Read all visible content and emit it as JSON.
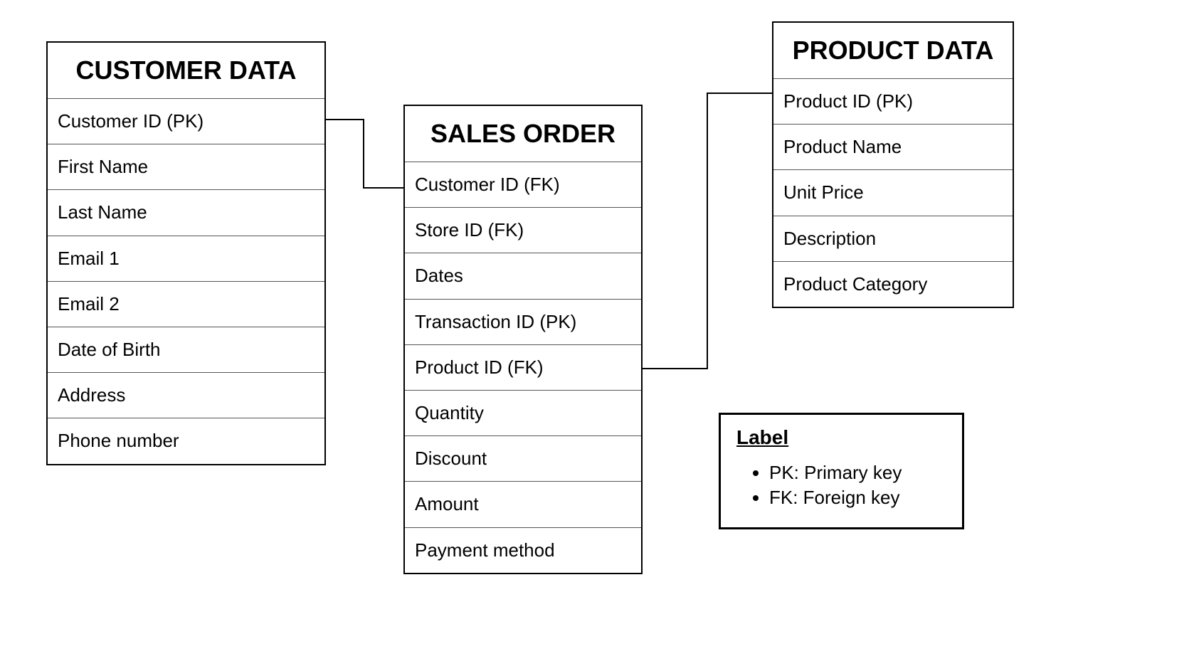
{
  "entities": {
    "customer": {
      "title": "CUSTOMER DATA",
      "fields": [
        "Customer ID (PK)",
        "First Name",
        "Last Name",
        "Email 1",
        "Email 2",
        "Date of Birth",
        "Address",
        "Phone number"
      ]
    },
    "sales": {
      "title": "SALES ORDER",
      "fields": [
        "Customer ID (FK)",
        "Store ID (FK)",
        "Dates",
        "Transaction ID (PK)",
        "Product ID (FK)",
        "Quantity",
        "Discount",
        "Amount",
        "Payment method"
      ]
    },
    "product": {
      "title": "PRODUCT DATA",
      "fields": [
        "Product ID (PK)",
        "Product Name",
        "Unit Price",
        "Description",
        "Product Category"
      ]
    }
  },
  "legend": {
    "title": "Label",
    "items": [
      "PK: Primary key",
      "FK: Foreign key"
    ]
  },
  "relationships": [
    {
      "from": "customer.Customer ID (PK)",
      "to": "sales.Customer ID (FK)"
    },
    {
      "from": "product.Product ID (PK)",
      "to": "sales.Product ID (FK)"
    }
  ]
}
